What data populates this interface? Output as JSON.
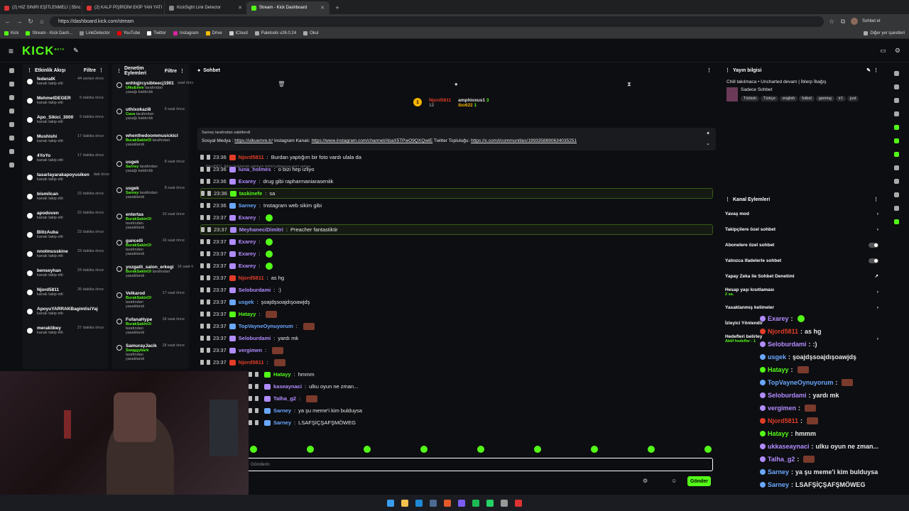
{
  "browser": {
    "tabs": [
      {
        "title": "(2) HIZ SINIRI EŞİTLENMELİ | 55ric"
      },
      {
        "title": "(2) KALP PİŞİRDİM EKİP YAN YATI"
      },
      {
        "title": "KickSight Link Detector"
      },
      {
        "title": "Stream - Kick Dashboard"
      }
    ],
    "url": "https://dashboard.kick.com/stream",
    "bookmarks": [
      "Kick",
      "Stream - Kick Dash...",
      "LinkDetector",
      "YouTube",
      "Twitter",
      "Instagram",
      "Drive",
      "iCloud",
      "Paletools v26.0.24",
      "Okul"
    ],
    "other_bookmarks": "Diğer yer işaretleri",
    "profile_chat": "Sohbet et"
  },
  "kick": {
    "logo": "KICK",
    "logo_beta": "BETA"
  },
  "activity": {
    "title": "Etkinlik Akışı",
    "filter": "Filtre",
    "items": [
      {
        "name": "federalK",
        "sub": "kanalı takip etti",
        "time": "44 saniye önce"
      },
      {
        "name": "MehmetDEGER",
        "sub": "kanalı takip etti",
        "time": "9 dakika önce"
      },
      {
        "name": "Apo_Sikici_3000",
        "sub": "kanalı takip etti",
        "time": "9 dakika önce"
      },
      {
        "name": "Mushishi",
        "sub": "kanalı takip etti",
        "time": "17 dakika önce"
      },
      {
        "name": "4YoYo",
        "sub": "kanalı takip etti",
        "time": "17 dakika önce"
      },
      {
        "name": "tasarlayarakapoyusiken",
        "sub": "kanalı takip etti",
        "time": "dak önce"
      },
      {
        "name": "bismilcan",
        "sub": "kanalı takip etti",
        "time": "22 dakika önce"
      },
      {
        "name": "apodoven",
        "sub": "kanalı takip etti",
        "time": "22 dakika önce"
      },
      {
        "name": "BlitzAuba",
        "sub": "kanalı takip etti",
        "time": "23 dakika önce"
      },
      {
        "name": "nnolmusskine",
        "sub": "kanalı takip etti",
        "time": "23 dakika önce"
      },
      {
        "name": "benseyhan",
        "sub": "kanalı takip etti",
        "time": "24 dakika önce"
      },
      {
        "name": "Njord5811",
        "sub": "kanalı takip etti",
        "time": "26 dakika önce"
      },
      {
        "name": "ApoyuYARRAKBagimlisiYaj",
        "sub": "kanalı takip etti",
        "time": ""
      },
      {
        "name": "meraklibey",
        "sub": "kanalı takip etti",
        "time": "27 dakika önce"
      }
    ]
  },
  "moderation": {
    "title": "Denetim Eylemleri",
    "filter": "Filtre",
    "items": [
      {
        "name": "enhtqjrcysibteecj1901",
        "mod": "UlkuEmre",
        "action": "tarafından yasağı kaldırıldı",
        "time": "saat önce"
      },
      {
        "name": "uthixokazi8",
        "mod": "Cava",
        "action": "tarafından yasağı kaldırıldı",
        "time": "6 saat önce"
      },
      {
        "name": "whenthedoommusickicl",
        "mod": "BurakSakinOl",
        "action": "tarafından yasaklandı",
        "time": ""
      },
      {
        "name": "usgek",
        "mod": "Sarney",
        "action": "tarafından yasağı kaldırıldı",
        "time": "8 saat önce"
      },
      {
        "name": "usgek",
        "mod": "Sarney",
        "action": "tarafından yasaklandı",
        "time": "8 saat önce"
      },
      {
        "name": "entertas",
        "mod": "BurakSakinOl",
        "action": "tarafından yasaklandı",
        "time": "10 saat önce"
      },
      {
        "name": "gancelli",
        "mod": "BurakSakinOl",
        "action": "tarafından yasaklandı",
        "time": "16 saat önce"
      },
      {
        "name": "yozgatli_salon_erkegi",
        "mod": "BurakSakinOl",
        "action": "tarafından yasaklandı",
        "time": "16 saat önce"
      },
      {
        "name": "Velkarod",
        "mod": "BurakSakinOl",
        "action": "tarafından yasaklandı",
        "time": "17 saat önce"
      },
      {
        "name": "FofanaHype",
        "mod": "BurakSakinOl",
        "action": "tarafından yasaklandı",
        "time": "18 saat önce"
      },
      {
        "name": "SamurayJacik",
        "mod": "Swaggybark",
        "action": "tarafından yasaklandı",
        "time": "18 saat önce"
      }
    ]
  },
  "chat": {
    "title": "Sohbet",
    "leaderboard": [
      {
        "name": "Njord5811",
        "value": "12"
      },
      {
        "name": "amphioxus1",
        "value": "3"
      },
      {
        "name": "ibo622",
        "value": "1"
      }
    ],
    "pinned": {
      "by": "Sarney tarafından sabitlendi",
      "text_prefix": "Sosyal Medya : ",
      "link1": "https://ulkuemre.tr/",
      "text_mid": " Instagram Kanalı: ",
      "link2": "https://www.instagram.com/channel/AbaX5TPwO9QXQwIE",
      "text_mid2": " Twitter Topluluğu: ",
      "link3": "https://x.com/i/communities/1993358890634035251"
    },
    "reply_hint": "Njord5811: Adını fısıldamak yetmiyor isimli kullanıcıya yanıt veriyor",
    "messages": [
      {
        "time": "23:36",
        "user": "Njord5811",
        "color": "#e23d28",
        "text": "Burdan yaptığım bir foto vardı ulala da",
        "highlight": false
      },
      {
        "time": "23:36",
        "user": "luna_holmes",
        "color": "#b18cff",
        "text": "o bizi hep izliyo",
        "highlight": false
      },
      {
        "time": "23:36",
        "user": "Exarey",
        "color": "#b18cff",
        "text": "drug gibi rapharmaniaraseniik",
        "highlight": false
      },
      {
        "time": "23:36",
        "user": "taskinefe",
        "color": "#53fc18",
        "text": "sa",
        "highlight": true
      },
      {
        "time": "23:36",
        "user": "Sarney",
        "color": "#6aa8ff",
        "text": "Instagram web sikim gibi",
        "highlight": false
      },
      {
        "time": "23:37",
        "user": "Exarey",
        "color": "#b18cff",
        "text": "",
        "highlight": false
      },
      {
        "time": "23:37",
        "user": "MeyhaneciDimitri",
        "color": "#b18cff",
        "text": "Preacher fantastiktir",
        "highlight": true
      },
      {
        "time": "23:37",
        "user": "Exarey",
        "color": "#b18cff",
        "text": "",
        "highlight": false
      },
      {
        "time": "23:37",
        "user": "Exarey",
        "color": "#b18cff",
        "text": "",
        "highlight": false
      },
      {
        "time": "23:37",
        "user": "Exarey",
        "color": "#b18cff",
        "text": "",
        "highlight": false
      },
      {
        "time": "23:37",
        "user": "Njord5811",
        "color": "#e23d28",
        "text": "as hg",
        "highlight": false
      },
      {
        "time": "23:37",
        "user": "Seloburdami",
        "color": "#b18cff",
        "text": ":)",
        "highlight": false
      },
      {
        "time": "23:37",
        "user": "usgek",
        "color": "#6aa8ff",
        "text": "şoajdşsoajdışoawjdş",
        "highlight": false
      },
      {
        "time": "23:37",
        "user": "Hatayy",
        "color": "#53fc18",
        "text": "",
        "highlight": false
      },
      {
        "time": "23:37",
        "user": "TopVayneOynuyorum",
        "color": "#6aa8ff",
        "text": "",
        "highlight": false
      },
      {
        "time": "23:37",
        "user": "Seloburdami",
        "color": "#b18cff",
        "text": "yardı mk",
        "highlight": false
      },
      {
        "time": "23:37",
        "user": "vergimen",
        "color": "#b18cff",
        "text": "",
        "highlight": false
      },
      {
        "time": "23:37",
        "user": "Njord5811",
        "color": "#e23d28",
        "text": "",
        "highlight": false
      },
      {
        "time": "",
        "user": "Hatayy",
        "color": "#53fc18",
        "text": "hmmm",
        "highlight": false
      },
      {
        "time": "",
        "user": "kaseaynaci",
        "color": "#b18cff",
        "text": "ulku oyun ne zman...",
        "highlight": false
      },
      {
        "time": "",
        "user": "Talha_g2",
        "color": "#b18cff",
        "text": "",
        "highlight": false
      },
      {
        "time": "",
        "user": "Sarney",
        "color": "#6aa8ff",
        "text": "ya şu meme'i kim bulduysa",
        "highlight": false
      },
      {
        "time": "",
        "user": "Sarney",
        "color": "#6aa8ff",
        "text": "LSAFŞİÇŞAFŞMÖWEG",
        "highlight": false
      }
    ],
    "input_placeholder": "Gönderin",
    "send": "Gönder"
  },
  "stream_info": {
    "title": "Yayın bilgisi",
    "stream_title": "Chill takılmaca • Uncharted devam | İblerp İbağış",
    "category": "Sadece Sohbet",
    "tags": [
      "Türkish",
      "Türkçe",
      "english",
      "futbol",
      "gaming",
      "ir1",
      "just"
    ]
  },
  "channel_actions": {
    "title": "Kanal Eylemleri",
    "items": [
      {
        "label": "Yavaş mod",
        "sub": "",
        "control": "arrow"
      },
      {
        "label": "Takipçilere özel sohbet",
        "sub": "",
        "control": "arrow"
      },
      {
        "label": "Abonelere özel sohbet",
        "sub": "",
        "control": "toggle"
      },
      {
        "label": "Yalnızca ifadelerle sohbet",
        "sub": "",
        "control": "toggle"
      },
      {
        "label": "Yapay Zeka ile Sohbet Denetimi",
        "sub": "",
        "control": "link"
      },
      {
        "label": "Hesap yaşı kısıtlaması",
        "sub": "2 sa.",
        "control": "arrow"
      },
      {
        "label": "Yasaklanmış kelimeler",
        "sub": "",
        "control": "arrow"
      },
      {
        "label": "İzleyici Yönlendir",
        "sub": "",
        "control": "none"
      },
      {
        "label": "Hedefleri belirley",
        "sub": "Aktif hedefler - 1",
        "control": "arrow"
      }
    ]
  },
  "overlay_chat": [
    {
      "user": "Exarey",
      "color": "#b18cff",
      "text": ""
    },
    {
      "user": "Njord5811",
      "color": "#e23d28",
      "text": "as hg"
    },
    {
      "user": "Seloburdami",
      "color": "#b18cff",
      "text": ":)"
    },
    {
      "user": "usgek",
      "color": "#6aa8ff",
      "text": "şoajdşsoajdışoawjdş"
    },
    {
      "user": "Hatayy",
      "color": "#53fc18",
      "text": ""
    },
    {
      "user": "TopVayneOynuyorum",
      "color": "#6aa8ff",
      "text": ""
    },
    {
      "user": "Seloburdami",
      "color": "#b18cff",
      "text": "yardı mk"
    },
    {
      "user": "vergimen",
      "color": "#b18cff",
      "text": ""
    },
    {
      "user": "Njord5811",
      "color": "#e23d28",
      "text": ""
    },
    {
      "user": "Hatayy",
      "color": "#53fc18",
      "text": "hmmm"
    },
    {
      "user": "ukkaseaynaci",
      "color": "#b18cff",
      "text": "ulku oyun ne zman..."
    },
    {
      "user": "Talha_g2",
      "color": "#b18cff",
      "text": ""
    },
    {
      "user": "Sarney",
      "color": "#6aa8ff",
      "text": "ya şu meme'i kim bulduysa"
    },
    {
      "user": "Sarney",
      "color": "#6aa8ff",
      "text": "LSAFŞİÇŞAFŞMÖWEG"
    }
  ],
  "colors": {
    "accent": "#53fc18",
    "bg": "#0d0e11",
    "panel": "#131417"
  }
}
